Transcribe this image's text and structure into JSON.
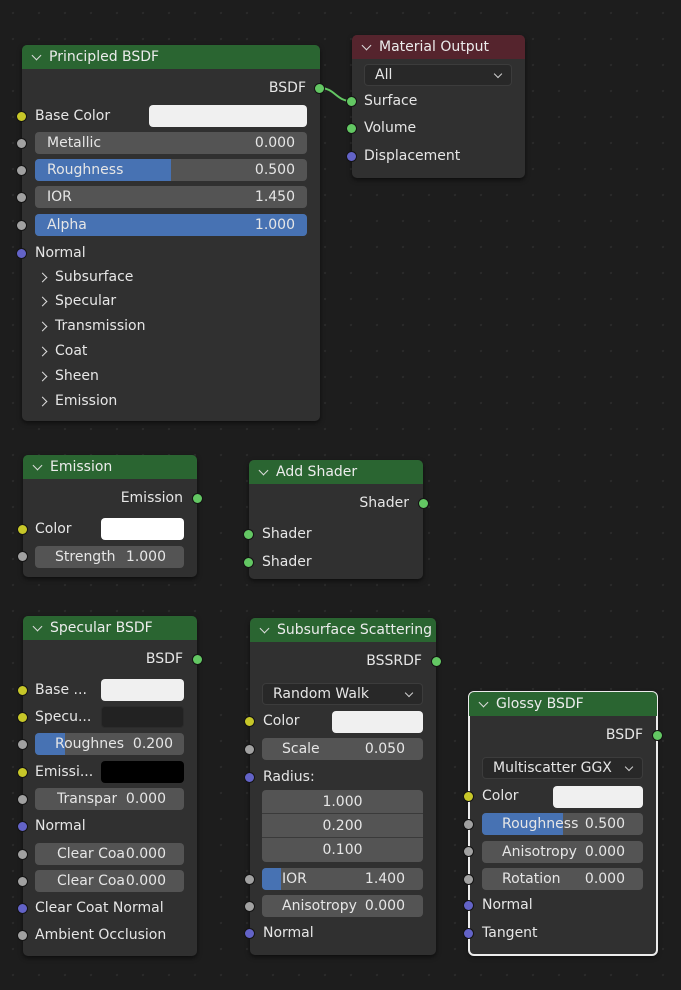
{
  "principled": {
    "title": "Principled BSDF",
    "output": "BSDF",
    "base_color_label": "Base Color",
    "base_color": "#f0f0f0",
    "metallic": {
      "label": "Metallic",
      "value": "0.000",
      "fraction": 0.0
    },
    "roughness": {
      "label": "Roughness",
      "value": "0.500",
      "fraction": 0.5
    },
    "ior": {
      "label": "IOR",
      "value": "1.450",
      "fraction": 0.0
    },
    "alpha": {
      "label": "Alpha",
      "value": "1.000",
      "fraction": 1.0
    },
    "normal": "Normal",
    "panels": [
      "Subsurface",
      "Specular",
      "Transmission",
      "Coat",
      "Sheen",
      "Emission"
    ]
  },
  "material_output": {
    "title": "Material Output",
    "target": "All",
    "inputs": [
      "Surface",
      "Volume",
      "Displacement"
    ]
  },
  "emission": {
    "title": "Emission",
    "output": "Emission",
    "color_label": "Color",
    "color": "#ffffff",
    "strength": {
      "label": "Strength",
      "value": "1.000"
    }
  },
  "add_shader": {
    "title": "Add Shader",
    "output": "Shader",
    "input1": "Shader",
    "input2": "Shader"
  },
  "specular": {
    "title": "Specular BSDF",
    "output": "BSDF",
    "base_color_label": "Base ...",
    "base_color": "#f0f0f0",
    "specular_label": "Specu...",
    "specular_color": "#222222",
    "roughness": {
      "label": "Roughnes",
      "value": "0.200",
      "fraction": 0.2
    },
    "emissive_label": "Emissi...",
    "emissive_color": "#000000",
    "transparency": {
      "label": "Transpar",
      "value": "0.000"
    },
    "normal": "Normal",
    "clear_coat": {
      "label": "Clear Coa",
      "value": "0.000"
    },
    "clear_coat_roughness": {
      "label": "Clear Coa",
      "value": "0.000"
    },
    "clear_coat_normal": "Clear Coat Normal",
    "ambient_occlusion": "Ambient Occlusion"
  },
  "subsurface": {
    "title": "Subsurface Scattering",
    "output": "BSSRDF",
    "method": "Random Walk",
    "color_label": "Color",
    "color": "#f0f0f0",
    "scale": {
      "label": "Scale",
      "value": "0.050"
    },
    "radius_label": "Radius:",
    "radius": [
      "1.000",
      "0.200",
      "0.100"
    ],
    "ior": {
      "label": "IOR",
      "value": "1.400",
      "fraction": 0.12
    },
    "anisotropy": {
      "label": "Anisotropy",
      "value": "0.000"
    },
    "normal": "Normal"
  },
  "glossy": {
    "title": "Glossy BSDF",
    "output": "BSDF",
    "distribution": "Multiscatter GGX",
    "color_label": "Color",
    "color": "#f0f0f0",
    "roughness": {
      "label": "Roughness",
      "value": "0.500",
      "fraction": 0.5
    },
    "anisotropy": {
      "label": "Anisotropy",
      "value": "0.000"
    },
    "rotation": {
      "label": "Rotation",
      "value": "0.000"
    },
    "normal": "Normal",
    "tangent": "Tangent"
  },
  "colors": {
    "header_shader": "#2a6531",
    "header_output": "#55242d",
    "socket_shader": "#63c763",
    "socket_color": "#c7c729",
    "socket_float": "#a1a1a1",
    "socket_vector": "#6363c7",
    "slider_fill": "#4772b3"
  }
}
